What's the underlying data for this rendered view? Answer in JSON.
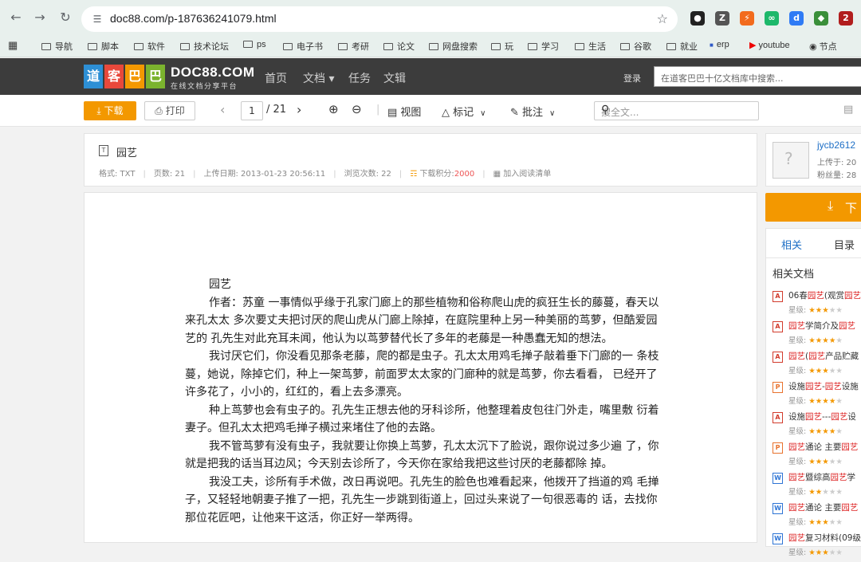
{
  "browser": {
    "url": "doc88.com/p-187636241079.html",
    "bookmarks": [
      "导航",
      "脚本",
      "软件",
      "技术论坛",
      "ps",
      "电子书",
      "考研",
      "论文",
      "网盘搜索",
      "玩",
      "学习",
      "生活",
      "谷歌",
      "就业",
      "erp",
      "youtube",
      "节点"
    ],
    "ext_badge": "2"
  },
  "site": {
    "logo_cn": "道客巴巴",
    "logo_en": "DOC88.COM",
    "logo_sub": "在线文档分享平台",
    "nav": [
      "首页",
      "文档 ▾",
      "任务",
      "文辑"
    ],
    "login": "登录",
    "search_placeholder": "在道客巴巴十亿文档库中搜索..."
  },
  "toolbar": {
    "download": "下载",
    "print": "打印",
    "page_current": "1",
    "page_total": "/ 21",
    "view": "视图",
    "mark": "标记",
    "annotate": "批注",
    "search_placeholder": "搜全文..."
  },
  "doc": {
    "title": "园艺",
    "format": "格式: TXT",
    "pages": "页数: 21",
    "upload_date": "上传日期: 2013-01-23 20:56:11",
    "views": "浏览次数: 22",
    "points_label": "下载积分:",
    "points_value": "2000",
    "add_reading": "加入阅读清单",
    "lines": [
      "园艺",
      "作者：苏童 一事情似乎缘于孔家门廊上的那些植物和俗称爬山虎的疯狂生长的藤蔓，春天以来孔太太 多次要丈夫把讨厌的爬山虎从门廊上除掉，在庭院里种上另一种美丽的茑萝，但酷爱园艺的 孔先生对此充耳未闻，他认为以茑萝替代长了多年的老藤是一种愚蠢无知的想法。",
      "我讨厌它们，你没看见那条老藤，爬的都是虫子。孔太太用鸡毛掸子敲着垂下门廊的一 条枝蔓，她说，除掉它们，种上一架茑萝，前面罗太太家的门廊种的就是茑萝，你去看看， 已经开了许多花了，小小的，红红的，看上去多漂亮。",
      "种上茑萝也会有虫子的。孔先生正想去他的牙科诊所，他整理着皮包往门外走，嘴里敷 衍着妻子。但孔太太把鸡毛掸子横过来堵住了他的去路。",
      "我不管茑萝有没有虫子，我就要让你换上茑萝，孔太太沉下了脸说，跟你说过多少遍 了，你就是把我的话当耳边风；今天别去诊所了，今天你在家给我把这些讨厌的老藤都除 掉。",
      "我没工夫，诊所有手术做，改日再说吧。孔先生的脸色也难看起来，他拨开了挡道的鸡 毛掸子，又轻轻地朝妻子推了一把，孔先生一步跳到街道上，回过头来说了一句很恶毒的 话，去找你那位花匠吧，让他来干这活，你正好一举两得。"
    ]
  },
  "sidebar": {
    "username": "jycb2612",
    "uploaded": "上传于: 20",
    "fans": "粉丝量: 28",
    "download": "下",
    "tab_related": "相关",
    "tab_toc": "目录",
    "related_title": "相关文档",
    "related": [
      {
        "type": "pdf",
        "pre": "06春",
        "hl": "园艺",
        "post": "(观赏",
        "hl2": "园艺",
        "stars": 3
      },
      {
        "type": "pdf",
        "pre": "",
        "hl": "园艺",
        "post": "学简介及",
        "hl2": "园艺",
        "stars": 4
      },
      {
        "type": "pdf",
        "pre": "",
        "hl": "园艺",
        "post": "(",
        "hl2": "园艺",
        "post2": "产品贮藏",
        "stars": 3
      },
      {
        "type": "ppt",
        "pre": "设施",
        "hl": "园艺",
        "post": "-",
        "hl2": "园艺",
        "post2": "设施",
        "stars": 4
      },
      {
        "type": "pdf",
        "pre": "设施",
        "hl": "园艺",
        "post": "---",
        "hl2": "园艺",
        "post2": "设",
        "stars": 4
      },
      {
        "type": "ppt",
        "pre": "",
        "hl": "园艺",
        "post": "通论 主要",
        "hl2": "园艺",
        "stars": 3
      },
      {
        "type": "doc",
        "pre": "",
        "hl": "园艺",
        "post": "暨综高",
        "hl2": "园艺",
        "post2": "学",
        "stars": 2
      },
      {
        "type": "doc",
        "pre": "",
        "hl": "园艺",
        "post": "通论 主要",
        "hl2": "园艺",
        "stars": 3
      },
      {
        "type": "doc",
        "pre": "",
        "hl": "园艺",
        "post": "复习材料(09级",
        "stars": 3
      }
    ],
    "star_label": "星级:"
  }
}
